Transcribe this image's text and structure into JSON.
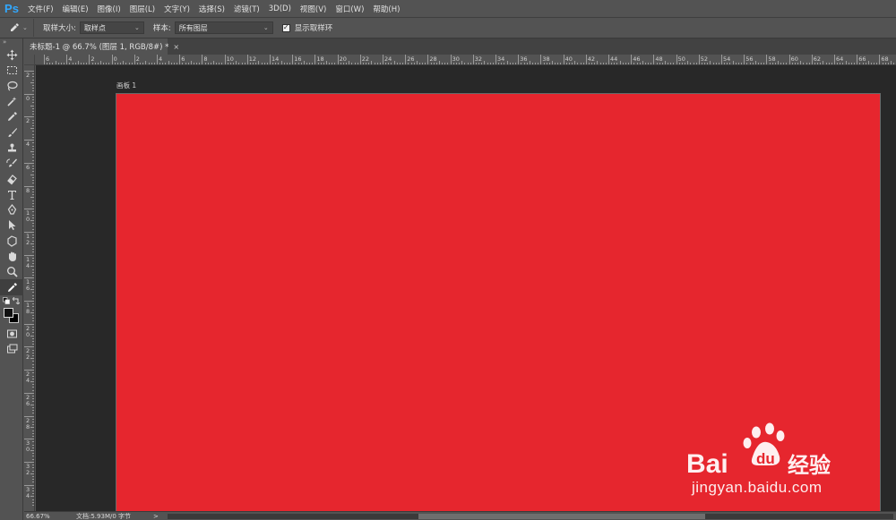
{
  "app": {
    "logo": "Ps"
  },
  "menu": {
    "items": [
      "文件(F)",
      "编辑(E)",
      "图像(I)",
      "图层(L)",
      "文字(Y)",
      "选择(S)",
      "滤镜(T)",
      "3D(D)",
      "视图(V)",
      "窗口(W)",
      "帮助(H)"
    ]
  },
  "options": {
    "tool_icon": "eyedropper-icon",
    "sample_size_label": "取样大小:",
    "sample_size_value": "取样点",
    "sample_label": "样本:",
    "sample_value": "所有图层",
    "show_ring_label": "显示取样环",
    "show_ring_checked": true
  },
  "tab": {
    "title": "未标题-1 @ 66.7% (图层 1, RGB/8#) *",
    "close": "×"
  },
  "rulers": {
    "horizontal": [
      "6",
      "4",
      "2",
      "0",
      "2",
      "4",
      "6",
      "8",
      "10",
      "12",
      "14",
      "16",
      "18",
      "20",
      "22",
      "24",
      "26",
      "28",
      "30",
      "32",
      "34",
      "36",
      "38",
      "40",
      "42",
      "44",
      "46",
      "48",
      "50",
      "52",
      "54",
      "56",
      "58",
      "60",
      "62",
      "64",
      "66",
      "68"
    ],
    "vertical": [
      "2",
      "0",
      "2",
      "4",
      "6",
      "8",
      "10",
      "12",
      "14",
      "16",
      "18",
      "20",
      "22",
      "24",
      "26",
      "28",
      "30",
      "32",
      "34"
    ]
  },
  "canvas": {
    "artboard_label": "画板 1",
    "fill_color": "#e6262e",
    "workspace_color": "#282828"
  },
  "status": {
    "zoom": "66.67%",
    "doc_info": "文档:5.93M/0 字节",
    "arrow": ">"
  },
  "watermark": {
    "brand": "Bai du 经验",
    "url": "jingyan.baidu.com"
  },
  "colors": {
    "accent": "#31a8ff",
    "panel": "#535353"
  }
}
